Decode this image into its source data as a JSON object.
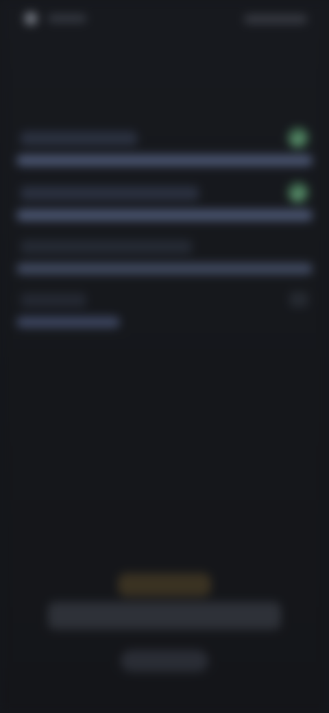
{
  "status": {
    "time": "",
    "indicators": ""
  },
  "header": {
    "title": ""
  },
  "rows": [
    {
      "title": "",
      "fill": 1.0,
      "state": "checked"
    },
    {
      "title": "",
      "fill": 1.0,
      "state": "checked"
    },
    {
      "title": "",
      "fill": 1.0,
      "state": "none"
    },
    {
      "title": "",
      "fill": 0.35,
      "state": "pending"
    }
  ],
  "footer": {
    "stars": "",
    "heading": "",
    "button_label": ""
  },
  "icons": {
    "check": "check-circle-icon",
    "status": "app-icon"
  },
  "colors": {
    "background": "#15171c",
    "accent_check": "#3f6b4f",
    "bar": "#3a4358",
    "star": "#a07b3c"
  }
}
